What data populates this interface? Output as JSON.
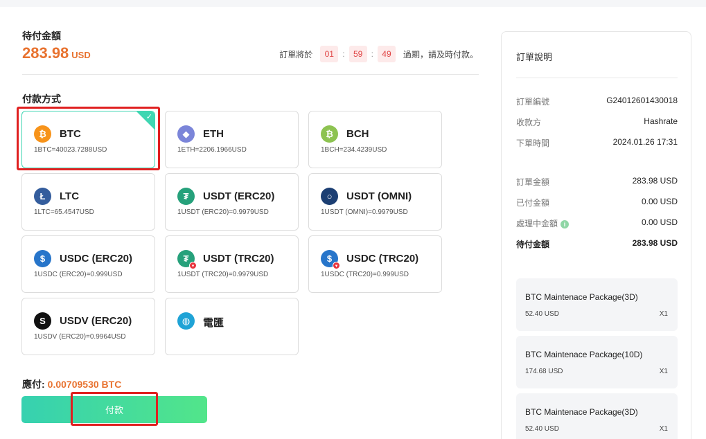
{
  "due": {
    "label": "待付金額",
    "amount": "283.98",
    "currency": "USD"
  },
  "timer": {
    "prefix": "訂單將於",
    "hh": "01",
    "mm": "59",
    "ss": "49",
    "sep": ":",
    "suffix": "過期，請及時付款。"
  },
  "payment_method_label": "付款方式",
  "methods": [
    {
      "name": "BTC",
      "rate": "1BTC=40023.7288USD",
      "icon": "bitcoin-icon",
      "color": "#f7931a",
      "glyph": "₿",
      "selected": true
    },
    {
      "name": "ETH",
      "rate": "1ETH=2206.1966USD",
      "icon": "ethereum-icon",
      "color": "#7b85d9",
      "glyph": "◆"
    },
    {
      "name": "BCH",
      "rate": "1BCH=234.4239USD",
      "icon": "bitcoin-cash-icon",
      "color": "#8dc351",
      "glyph": "₿"
    },
    {
      "name": "LTC",
      "rate": "1LTC=65.4547USD",
      "icon": "litecoin-icon",
      "color": "#345d9d",
      "glyph": "Ł"
    },
    {
      "name": "USDT (ERC20)",
      "rate": "1USDT (ERC20)=0.9979USD",
      "icon": "tether-icon",
      "color": "#26a17b",
      "glyph": "₮"
    },
    {
      "name": "USDT (OMNI)",
      "rate": "1USDT (OMNI)=0.9979USD",
      "icon": "omni-icon",
      "color": "#1c3f73",
      "glyph": "○"
    },
    {
      "name": "USDC (ERC20)",
      "rate": "1USDC (ERC20)=0.999USD",
      "icon": "usdc-icon",
      "color": "#2775ca",
      "glyph": "$"
    },
    {
      "name": "USDT (TRC20)",
      "rate": "1USDT (TRC20)=0.9979USD",
      "icon": "tether-tron-icon",
      "color": "#26a17b",
      "glyph": "₮",
      "badge": true
    },
    {
      "name": "USDC (TRC20)",
      "rate": "1USDC (TRC20)=0.999USD",
      "icon": "usdc-tron-icon",
      "color": "#2775ca",
      "glyph": "$",
      "badge": true
    },
    {
      "name": "USDV (ERC20)",
      "rate": "1USDV (ERC20)=0.9964USD",
      "icon": "usdv-icon",
      "color": "#111111",
      "glyph": "S"
    },
    {
      "name": "電匯",
      "rate": "",
      "icon": "globe-wire-icon",
      "color": "#1fa3d6",
      "glyph": "◍"
    }
  ],
  "should_pay": {
    "label": "應付:",
    "value": "0.00709530 BTC"
  },
  "pay_button": "付款",
  "order": {
    "title": "訂單說明",
    "rows": [
      {
        "label": "訂單編號",
        "value": "G24012601430018"
      },
      {
        "label": "收款方",
        "value": "Hashrate"
      },
      {
        "label": "下單時間",
        "value": "2024.01.26 17:31"
      }
    ],
    "amount_rows": [
      {
        "label": "訂單金額",
        "value": "283.98 USD"
      },
      {
        "label": "已付金額",
        "value": "0.00 USD"
      },
      {
        "label": "處理中金額",
        "value": "0.00 USD",
        "info": true
      },
      {
        "label": "待付金額",
        "value": "283.98 USD",
        "bold": true
      }
    ],
    "packages": [
      {
        "name": "BTC Maintenace Package(3D)",
        "price": "52.40 USD",
        "qty": "X1"
      },
      {
        "name": "BTC Maintenace Package(10D)",
        "price": "174.68 USD",
        "qty": "X1"
      },
      {
        "name": "BTC Maintenace Package(3D)",
        "price": "52.40 USD",
        "qty": "X1"
      }
    ]
  }
}
